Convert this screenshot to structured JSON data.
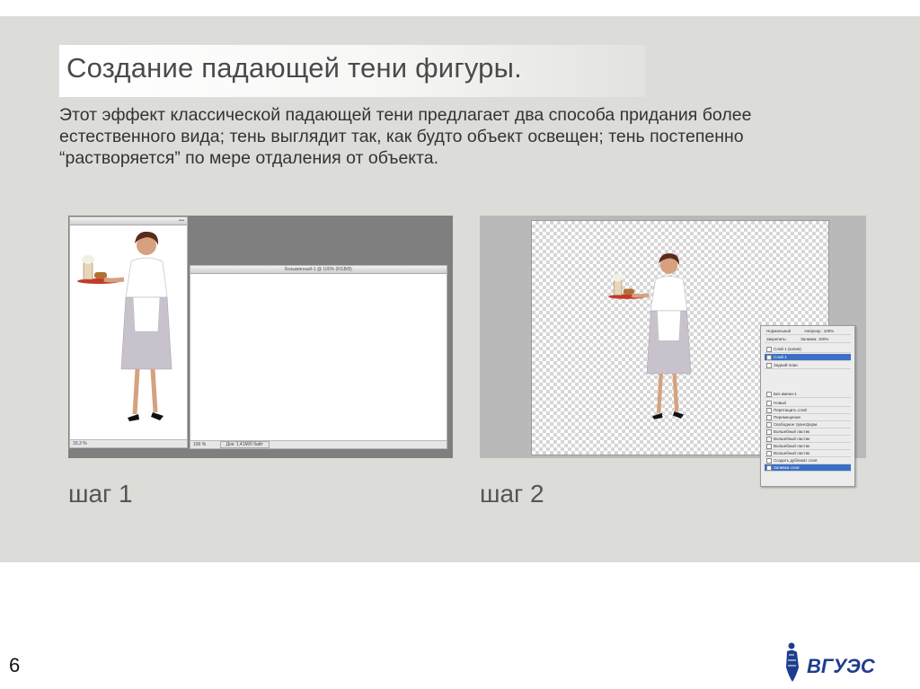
{
  "slide": {
    "title": "Создание падающей тени фигуры.",
    "description": "Этот эффект классической падающей тени предлагает два способа придания более естественного вида; тень выглядит так, как будто объект освещен; тень постепенно “растворяется” по мере отдаления от объекта.",
    "steps": [
      {
        "label": "шаг 1"
      },
      {
        "label": "шаг 2"
      }
    ],
    "page_number": "6"
  },
  "step1_screenshot": {
    "window1": {
      "status": "33,3 %"
    },
    "window2": {
      "title": "Безымянный-1 @ 100% (RGB/8)",
      "status": "100 %",
      "status_doc": "Док: 1,41M/0 байт"
    }
  },
  "layers_panel": {
    "header_mode": "Нормальный",
    "header_opacity": "Непрозр.: 100%",
    "lock_label": "Закрепить:",
    "fill": "Заливка: 100%",
    "layers": [
      {
        "name": "Слой 1 (копия)",
        "selected": false
      },
      {
        "name": "Слой 1",
        "selected": true
      },
      {
        "name": "Задний план",
        "selected": false
      }
    ],
    "history_title": "Без имени-1",
    "history": [
      {
        "name": "Новый",
        "selected": false
      },
      {
        "name": "Перетащить слой",
        "selected": false
      },
      {
        "name": "Перемещение",
        "selected": false
      },
      {
        "name": "Свободное трансформ.",
        "selected": false
      },
      {
        "name": "Волшебный ластик",
        "selected": false
      },
      {
        "name": "Волшебный ластик",
        "selected": false
      },
      {
        "name": "Волшебный ластик",
        "selected": false
      },
      {
        "name": "Волшебный ластик",
        "selected": false
      },
      {
        "name": "Создать дубликат слоя",
        "selected": false
      },
      {
        "name": "Заливка слоя",
        "selected": true
      }
    ]
  },
  "logo": {
    "text": "ВГУЭС"
  },
  "colors": {
    "slide_bg": "#dcdcd8",
    "logo_blue": "#1e3d8f",
    "selection": "#3b6fc4"
  }
}
